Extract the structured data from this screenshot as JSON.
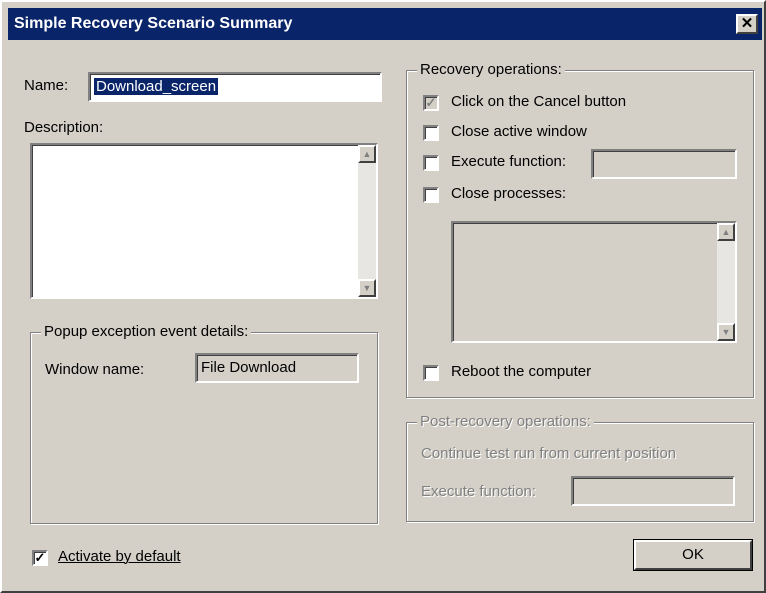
{
  "window": {
    "title": "Simple Recovery Scenario Summary",
    "close_glyph": "✕"
  },
  "name_field": {
    "label": "Name:",
    "value": "Download_screen"
  },
  "description": {
    "label": "Description:",
    "value": ""
  },
  "popup_group": {
    "legend": "Popup exception event details:",
    "window_name_label": "Window name:",
    "window_name_value": "File Download"
  },
  "recovery_group": {
    "legend": "Recovery operations:",
    "click_cancel": {
      "label": "Click on the Cancel button",
      "checked": true
    },
    "close_active": {
      "label": "Close active window",
      "checked": false
    },
    "execute_function": {
      "label": "Execute function:",
      "checked": false,
      "value": ""
    },
    "close_processes": {
      "label": "Close processes:",
      "checked": false
    },
    "reboot": {
      "label": "Reboot the computer",
      "checked": false
    }
  },
  "post_recovery_group": {
    "legend": "Post-recovery operations:",
    "continue_text": "Continue test run from current position",
    "execute_function_label": "Execute function:",
    "execute_function_value": ""
  },
  "activate_default": {
    "label": "Activate by default",
    "checked": true
  },
  "buttons": {
    "ok": "OK"
  },
  "glyphs": {
    "check": "✓",
    "scroll_up": "▲",
    "scroll_down": "▼"
  },
  "colors": {
    "titlebar": "#0a246a",
    "dialog_face": "#d4d0c8",
    "disabled_text": "#808080"
  }
}
